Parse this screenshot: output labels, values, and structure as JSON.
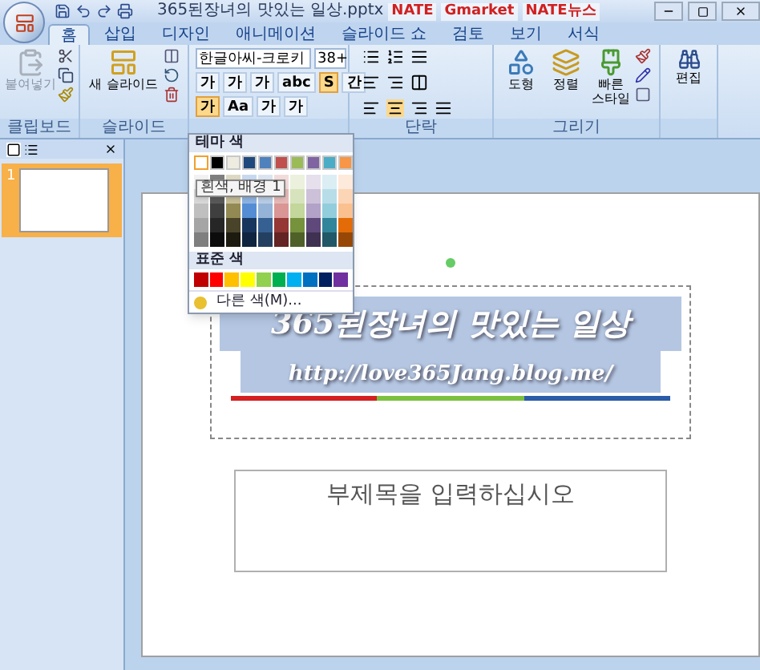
{
  "window": {
    "title": "365된장녀의 맛있는 일상.pptx",
    "extras": [
      "NATE",
      "Gmarket",
      "NATE뉴스"
    ]
  },
  "tabs": [
    {
      "label": "홈",
      "selected": true
    },
    {
      "label": "삽입",
      "selected": false
    },
    {
      "label": "디자인",
      "selected": false
    },
    {
      "label": "애니메이션",
      "selected": false
    },
    {
      "label": "슬라이드 쇼",
      "selected": false
    },
    {
      "label": "검토",
      "selected": false
    },
    {
      "label": "보기",
      "selected": false
    },
    {
      "label": "서식",
      "selected": false
    }
  ],
  "ribbon": {
    "clipboard": {
      "label": "클립보드",
      "paste": {
        "label": "붙여넣기",
        "disabled": true
      }
    },
    "slides": {
      "label": "슬라이드",
      "new_slide": "새 슬라이드"
    },
    "font": {
      "name": "한글아씨-크로키",
      "size": "38+",
      "row_1": [
        {
          "label": "가",
          "selected": false
        },
        {
          "label": "가",
          "selected": false
        },
        {
          "label": "가",
          "selected": false
        },
        {
          "label": "abc",
          "selected": false
        },
        {
          "label": "S",
          "selected": true
        },
        {
          "label": "간",
          "selected": false
        }
      ],
      "row_2": [
        {
          "label": "가",
          "selected": true
        },
        {
          "label": "Aa",
          "selected": false
        },
        {
          "label": "가",
          "selected": false
        },
        {
          "label": "가",
          "selected": false
        }
      ]
    },
    "paragraph": {
      "label": "단락"
    },
    "drawing": {
      "label": "그리기",
      "buttons": [
        "도형",
        "정렬",
        "빠른 스타일"
      ]
    },
    "editing": {
      "button": "편집"
    }
  },
  "slide_pane": {
    "thumbnails": [
      {
        "number": "1",
        "selected": true
      }
    ]
  },
  "slide": {
    "title": "365된장녀의 맛있는 일상",
    "url": "http://love365Jang.blog.me/",
    "subtitle_placeholder": "부제목을 입력하십시오"
  },
  "color_menu": {
    "theme_header": "테마 색",
    "theme_colors": [
      {
        "color": "#ffffff",
        "selected": true,
        "shades": [
          {
            "color": "#f2f2f2"
          },
          {
            "color": "#d8d8d8"
          },
          {
            "color": "#bfbfbf"
          },
          {
            "color": "#a5a5a5"
          },
          {
            "color": "#7f7f7f"
          }
        ]
      },
      {
        "color": "#000000",
        "selected": false,
        "shades": [
          {
            "color": "#7f7f7f"
          },
          {
            "color": "#595959"
          },
          {
            "color": "#3f3f3f"
          },
          {
            "color": "#262626"
          },
          {
            "color": "#0c0c0c"
          }
        ]
      },
      {
        "color": "#eeece1",
        "selected": false,
        "shades": [
          {
            "color": "#ddd9c3"
          },
          {
            "color": "#c4bd97"
          },
          {
            "color": "#938953"
          },
          {
            "color": "#494429"
          },
          {
            "color": "#1d1b10"
          }
        ]
      },
      {
        "color": "#1f497d",
        "selected": false,
        "shades": [
          {
            "color": "#c6d9f0"
          },
          {
            "color": "#8db3e2"
          },
          {
            "color": "#548dd4"
          },
          {
            "color": "#17365d"
          },
          {
            "color": "#0f243e"
          }
        ]
      },
      {
        "color": "#4f81bd",
        "selected": false,
        "shades": [
          {
            "color": "#dbe5f1"
          },
          {
            "color": "#b8cce4"
          },
          {
            "color": "#95b3d7"
          },
          {
            "color": "#366092"
          },
          {
            "color": "#244061"
          }
        ]
      },
      {
        "color": "#c0504d",
        "selected": false,
        "shades": [
          {
            "color": "#f2dcdb"
          },
          {
            "color": "#e5b9b7"
          },
          {
            "color": "#d99694"
          },
          {
            "color": "#953734"
          },
          {
            "color": "#632423"
          }
        ]
      },
      {
        "color": "#9bbb59",
        "selected": false,
        "shades": [
          {
            "color": "#ebf1dd"
          },
          {
            "color": "#d7e3bc"
          },
          {
            "color": "#c3d69b"
          },
          {
            "color": "#76923c"
          },
          {
            "color": "#4f6128"
          }
        ]
      },
      {
        "color": "#8064a2",
        "selected": false,
        "shades": [
          {
            "color": "#e5e0ec"
          },
          {
            "color": "#ccc1d9"
          },
          {
            "color": "#b2a2c7"
          },
          {
            "color": "#5f497a"
          },
          {
            "color": "#3f3151"
          }
        ]
      },
      {
        "color": "#4bacc6",
        "selected": false,
        "shades": [
          {
            "color": "#dbeef3"
          },
          {
            "color": "#b7dde8"
          },
          {
            "color": "#92cddc"
          },
          {
            "color": "#31859b"
          },
          {
            "color": "#205867"
          }
        ]
      },
      {
        "color": "#f79646",
        "selected": false,
        "shades": [
          {
            "color": "#fdeada"
          },
          {
            "color": "#fbd5b5"
          },
          {
            "color": "#fac08f"
          },
          {
            "color": "#e36c09"
          },
          {
            "color": "#974806"
          }
        ]
      }
    ],
    "tooltip": "흰색, 배경 1",
    "standard_header": "표준 색",
    "standard_colors": [
      {
        "color": "#c00000"
      },
      {
        "color": "#ff0000"
      },
      {
        "color": "#ffc000"
      },
      {
        "color": "#ffff00"
      },
      {
        "color": "#92d050"
      },
      {
        "color": "#00b050"
      },
      {
        "color": "#00b0f0"
      },
      {
        "color": "#0070c0"
      },
      {
        "color": "#002060"
      },
      {
        "color": "#7030a0"
      }
    ],
    "more_colors": "다른 색(M)..."
  }
}
